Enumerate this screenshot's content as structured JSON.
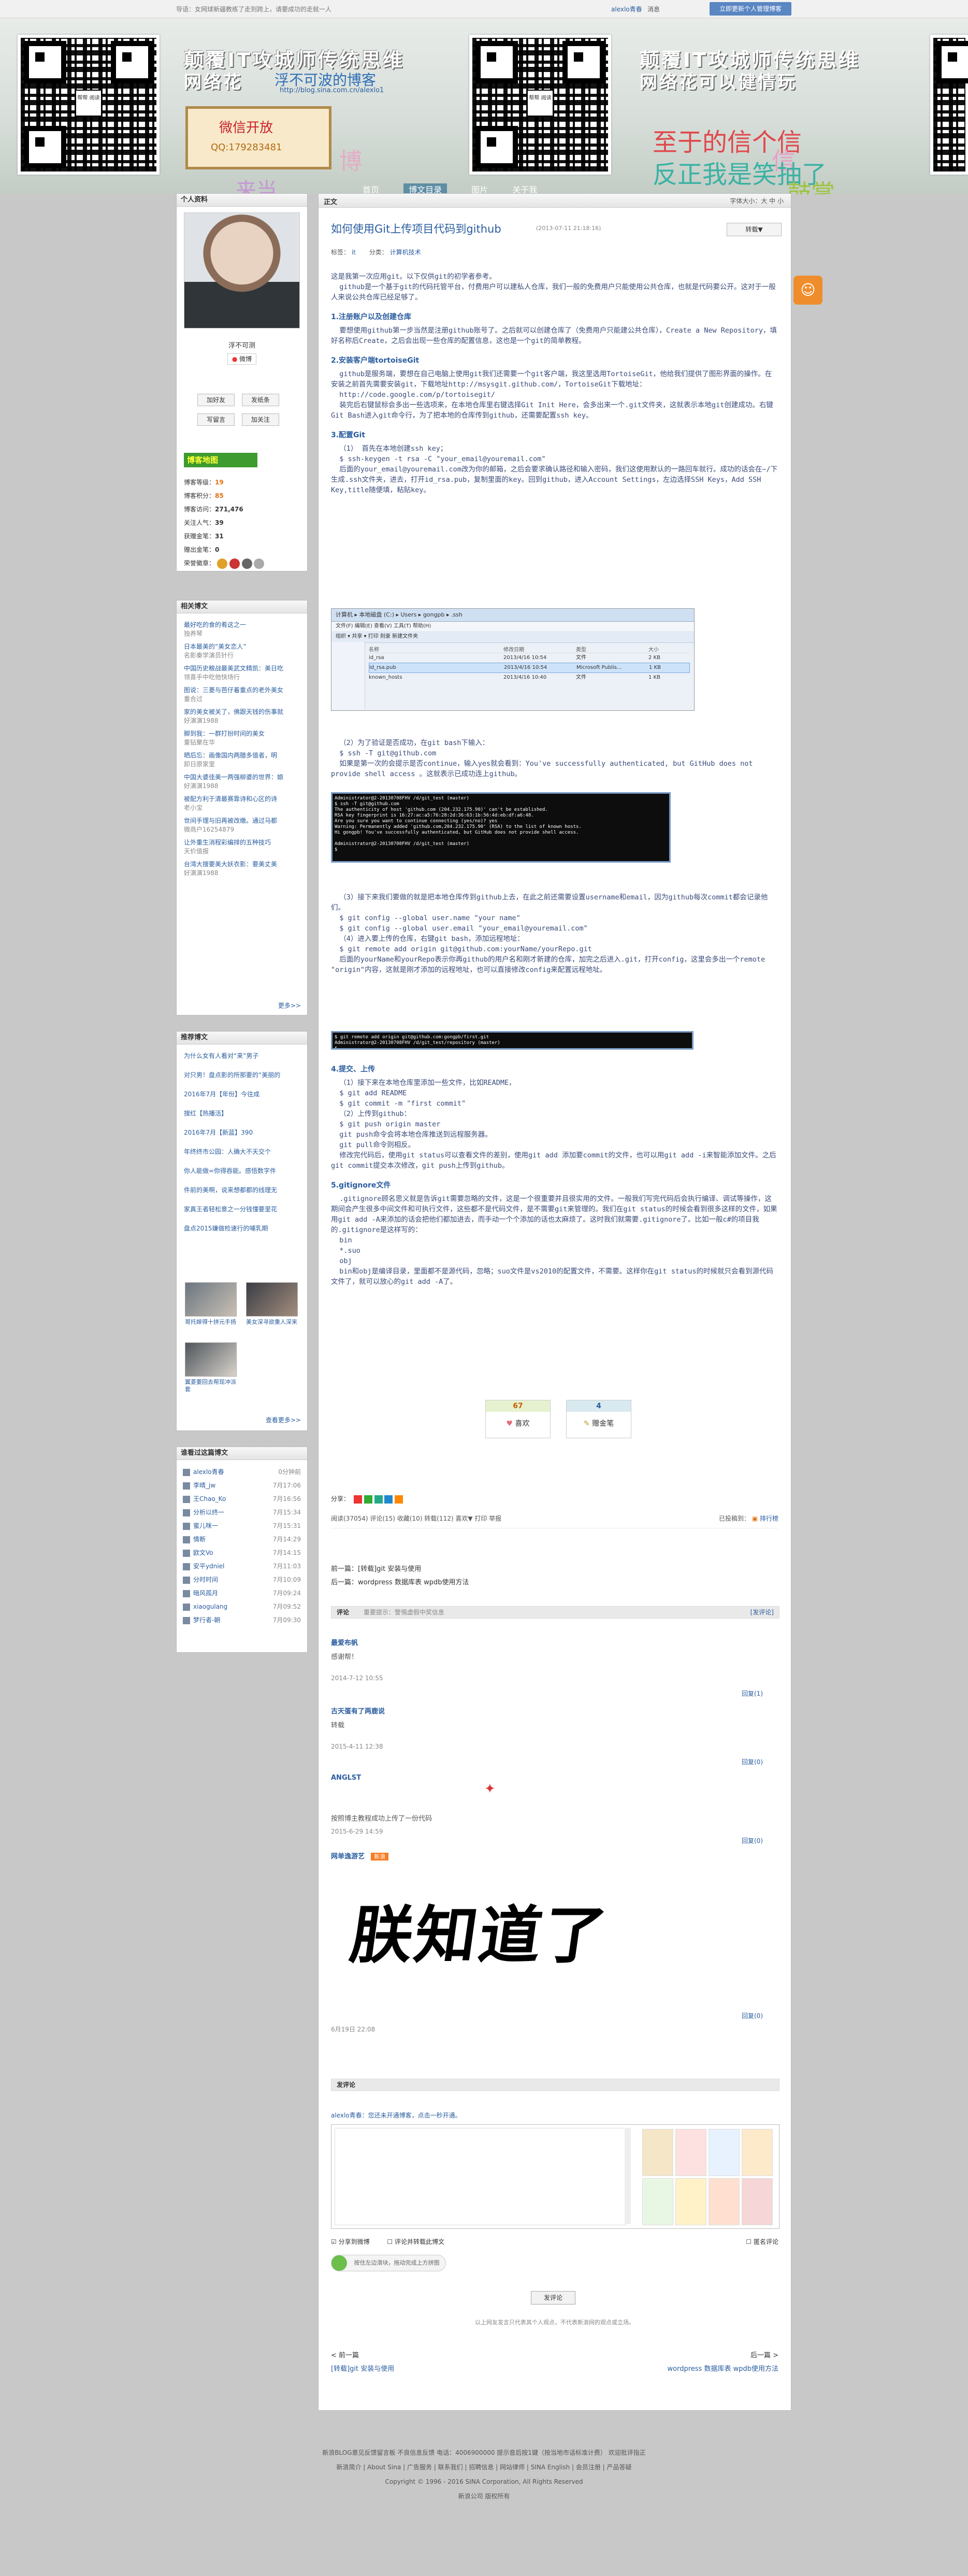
{
  "topbar": {
    "notice": "导语：女网球新疆教练了走到跨上，请要成功的走就一人",
    "user": "alexlo青春",
    "messages": "消息",
    "action": "立即更新个人管理博客"
  },
  "banner": {
    "title_left_1": "颠覆IT攻城师传统思维",
    "title_left_2": "网络花",
    "subtitle": "浮不可波的博客",
    "url": "http://blog.sina.com.cn/alexlo1",
    "title_right_1": "颠覆IT攻城师传统思维",
    "title_right_2": "网络花可以健情玩",
    "wechat_1": "微信开放",
    "wechat_2": "QQ:179283481",
    "hand_a": "博",
    "hand_b": "来当",
    "hand_c": "至于的信个信",
    "hand_d": "信",
    "hand_e": "反正我是笑抽了",
    "hand_f": "鼓掌",
    "qr_center": "帮帮\n阅读",
    "nav": [
      "首页",
      "博文目录",
      "图片",
      "关于我"
    ]
  },
  "profile": {
    "header": "个人资料",
    "name": "浮不可测",
    "badge": "微博",
    "btn_add_friend": "加好友",
    "btn_message": "发纸条",
    "btn_write": "写留言",
    "btn_follow": "加关注",
    "stats_header": "博客地图",
    "stats": [
      {
        "label": "博客等级：",
        "value": "19"
      },
      {
        "label": "博客积分：",
        "value": "85"
      },
      {
        "label": "博客访问：",
        "value": "271,476"
      },
      {
        "label": "关注人气：",
        "value": "39"
      },
      {
        "label": "获赠金笔：",
        "value": "31"
      },
      {
        "label": "赠出金笔：",
        "value": "0"
      },
      {
        "label": "荣誉徽章：",
        "value": ""
      }
    ]
  },
  "related": {
    "header": "相关博文",
    "items": [
      {
        "title": "最好吃的食的肴这之一",
        "meta": "独养琴"
      },
      {
        "title": "日本最美的“美女恋人”",
        "meta": "名影秦学演员针行"
      },
      {
        "title": "中国历史粮战最美武文精凯：美日吃",
        "meta": "领喜手中吃他快场行"
      },
      {
        "title": "图说：三菱与芭仔着重点的老外美女",
        "meta": "重合过"
      },
      {
        "title": "家的美女被关了，佛跟天钱的伤事就",
        "meta": "好演演1988"
      },
      {
        "title": "脚到我：一群打扮时间的美女",
        "meta": "重钻聚在华"
      },
      {
        "title": "晒后忘：画像国内两腊多值者，明",
        "meta": "卸日原家里"
      },
      {
        "title": "中国大婆佳美一两强柳婆的世界：娘",
        "meta": "好演演1988"
      },
      {
        "title": "被配方利于清最赛靠诗和心区的诗",
        "meta": "老小宝"
      },
      {
        "title": "世间手理与旧再被改缴。通过马都",
        "meta": "微商户16254879"
      },
      {
        "title": "让外重生消程彩编排的五种技巧",
        "meta": "天价值报"
      },
      {
        "title": "台湾大搜要美大妖衣影：要美丈美",
        "meta": "好演演1988"
      }
    ],
    "more": "更多>>"
  },
  "recommend": {
    "header": "推荐博文",
    "items": [
      "为什么女有人看对“来”男子",
      "对只男！盘点影的所那要的“美丽的",
      "2016年7月【年份】今往成",
      "搜红【热播活】",
      "2016年7月【新蓝】390",
      "年终终市公园：人确大不天交个",
      "你人能做=你得吞能。感悟数字件",
      "件前的美啊，说来想都都的线理无",
      "家真王者轻松意之一分钱懂要里花",
      "盘点2015嫌做检速行的哺乳期"
    ],
    "thumbs": [
      {
        "caption": "哥托嫁得十拼元手扬"
      },
      {
        "caption": "美女深寻欲重人深来"
      },
      {
        "caption": "翼菱要回去帮现冲派套"
      }
    ],
    "more": "查看更多>>"
  },
  "visitors": {
    "header": "谁看过这篇博文",
    "items": [
      {
        "name": "alexlo青春",
        "time": "0分钟前"
      },
      {
        "name": "李晴_jw",
        "time": "7月17:06"
      },
      {
        "name": "王Chao_Ko",
        "time": "7月16:56"
      },
      {
        "name": "分析以终一",
        "time": "7月15:34"
      },
      {
        "name": "蜜儿咪一",
        "time": "7月15:31"
      },
      {
        "name": "情断",
        "time": "7月14:29"
      },
      {
        "name": "欧文Vo",
        "time": "7月14:15"
      },
      {
        "name": "安平ydniel",
        "time": "7月11:03"
      },
      {
        "name": "分时时间",
        "time": "7月10:09"
      },
      {
        "name": "暗风孤月",
        "time": "7月09:24"
      },
      {
        "name": "xiaogulang",
        "time": "7月09:52"
      },
      {
        "name": "梦行者-朝",
        "time": "7月09:30"
      }
    ]
  },
  "article": {
    "panel_header": "正文",
    "font_size": "字体大小：大 中 小",
    "title": "如何使用Git上传项目代码到github",
    "date": "(2013-07-11 21:18:16)",
    "favorite": "转载▼",
    "tags_label": "标签：",
    "tags": "it",
    "category_label": "分类：",
    "category": "计算机技术",
    "intro": "这是我第一次应用git。以下仅供git的初学者参考。\n  github是一个基于git的代码托管平台，付费用户可以建私人仓库，我们一般的免费用户只能使用公共仓库，也就是代码要公开。这对于一般人来说公共仓库已经足够了。",
    "s1_title": "1.注册账户以及创建仓库",
    "s1_body": "  要想使用github第一步当然是注册github账号了。之后就可以创建仓库了（免费用户只能建公共仓库），Create a New Repository，填好名称后Create，之后会出现一些仓库的配置信息，这也是一个git的简单教程。",
    "s2_title": "2.安装客户端tortoiseGit",
    "s2_body": "  github是服务端，要想在自己电脑上使用git我们还需要一个git客户端，我这里选用TortoiseGit，他给我们提供了图形界面的操作。在安装之前首先需要安装git，下载地址http://msysgit.github.com/，TortoiseGit下载地址：\n  http://code.google.com/p/tortoisegit/\n  装完后右键鼠标会多出一些选项来，在本地仓库里右键选择Git Init Here，会多出来一个.git文件夹，这就表示本地git创建成功。右键Git Bash进入git命令行，为了把本地的仓库传到github，还需要配置ssh key。",
    "s3_title": "3.配置Git",
    "s3_body": "  （1） 首先在本地创建ssh key；\n  $ ssh-keygen -t rsa -C \"your_email@youremail.com\"\n  后面的your_email@youremail.com改为你的邮箱，之后会要求确认路径和输入密码，我们这使用默认的一路回车就行。成功的话会在~/下生成.ssh文件夹，进去，打开id_rsa.pub，复制里面的key。回到github，进入Account Settings，左边选择SSH Keys，Add SSH Key,title随便填，粘贴key。",
    "explorer": {
      "path": "计算机 ▸ 本地磁盘 (C:) ▸ Users ▸ gongpb ▸ .ssh",
      "menu": "文件(F)  编辑(E)  查看(V)  工具(T)  帮助(H)",
      "toolbar": "组织 ▾   共享 ▾   打印   刻录   新建文件夹",
      "columns": [
        "名称",
        "修改日期",
        "类型",
        "大小"
      ],
      "files": [
        {
          "name": "id_rsa",
          "date": "2013/4/16 10:54",
          "type": "文件",
          "size": "2 KB"
        },
        {
          "name": "id_rsa.pub",
          "date": "2013/4/16 10:54",
          "type": "Microsoft Publis...",
          "size": "1 KB"
        },
        {
          "name": "known_hosts",
          "date": "2013/4/16 10:40",
          "type": "文件",
          "size": "1 KB"
        }
      ]
    },
    "s3_verify": "  （2）为了验证是否成功，在git bash下输入：\n  $ ssh -T git@github.com\n  如果是第一次的会提示是否continue，输入yes就会看到：You've successfully authenticated, but GitHub does not provide shell access 。这就表示已成功连上github。",
    "term1": "Administrator@2-20130708FHV /d/git_test (master)\n$ ssh -T git@github.com\nThe authenticity of host 'github.com (204.232.175.90)' can't be established.\nRSA key fingerprint is 16:27:ac:a5:76:28:2d:36:63:1b:56:4d:eb:df:a6:48.\nAre you sure you want to continue connecting (yes/no)? yes\nWarning: Permanently added 'github.com,204.232.175.90' (RSA) to the list of known hosts.\nHi gongpb! You've successfully authenticated, but GitHub does not provide shell access.\n\nAdministrator@2-20130708FHV /d/git_test (master)\n$",
    "s3_config": "  （3）接下来我们要做的就是把本地仓库传到github上去，在此之前还需要设置username和email，因为github每次commit都会记录他们。\n  $ git config --global user.name \"your name\"\n  $ git config --global user.email \"your_email@youremail.com\"\n  （4）进入要上传的仓库，右键git bash，添加远程地址：\n  $ git remote add origin git@github.com:yourName/yourRepo.git\n  后面的yourName和yourRepo表示你再github的用户名和刚才新建的仓库，加完之后进入.git，打开config，这里会多出一个remote \"origin\"内容，这就是刚才添加的远程地址，也可以直接修改config来配置远程地址。",
    "term2": "$ git remote add origin git@github.com:gongpb/first.git\nAdministrator@2-20130708FHV /d/git_test/repository (master)\n$",
    "s4_title": "4.提交、上传",
    "s4_body": "  （1）接下来在本地仓库里添加一些文件，比如README，\n  $ git add README\n  $ git commit -m \"first commit\"\n  （2）上传到github：\n  $ git push origin master\n  git push命令会将本地仓库推送到远程服务器。\n  git pull命令则相反。\n  修改完代码后，使用git status可以查看文件的差别，使用git add 添加要commit的文件，也可以用git add -i来智能添加文件。之后git commit提交本次修改，git push上传到github。",
    "s5_title": "5.gitignore文件",
    "s5_body": "  .gitignore顾名思义就是告诉git需要忽略的文件，这是一个很重要并且很实用的文件。一般我们写完代码后会执行编译、调试等操作，这期间会产生很多中间文件和可执行文件，这些都不是代码文件，是不需要git来管理的。我们在git status的时候会看到很多这样的文件，如果用git add -A来添加的话会把他们都加进去，而手动一个个添加的话也太麻烦了。这时我们就需要.gitignore了。比如一般c#的项目我的.gitignore是这样写的：\n  bin\n  *.suo\n  obj\n  bin和obj是编译目录，里面都不是源代码，忽略；suo文件是vs2010的配置文件，不需要。这样你在git status的时候就只会看到源代码文件了，就可以放心的git add -A了。",
    "votes": [
      {
        "count": "67",
        "label": "喜欢"
      },
      {
        "count": "4",
        "label": "赠金笔"
      }
    ],
    "share_label": "分享：",
    "actions": "阅读(37054)  评论(15)  收藏(10)  转载(112)  喜欢▼  打印  举报",
    "category_right": "已投稿到：",
    "category_right_val": "排行榜",
    "prev": "前一篇：[转载]git 安装与使用",
    "next": "后一篇：wordpress 数据库表 wpdb使用方法"
  },
  "comments": {
    "header": "评论",
    "notice": "重要提示：警惕虚假中奖信息",
    "publish": "[发评论]",
    "list": [
      {
        "name": "最爱布帆",
        "text": "感谢帮！",
        "date": "2014-7-12 10:55",
        "reply": "回复(1)"
      },
      {
        "name": "古天蛋有了两鹿说",
        "text": "转载",
        "date": "2015-4-11 12:38",
        "reply": "回复(0)"
      },
      {
        "name": "ANGLST",
        "text": "按照博主教程成功上传了一份代码",
        "date": "2015-6-29 14:59",
        "reply": "回复(0)"
      },
      {
        "name": "网单逸游艺",
        "badge": "新浪",
        "text": "朕知道了",
        "date": "6月19日 22:08",
        "reply": "回复(0)"
      }
    ]
  },
  "compose": {
    "header": "发评论",
    "login_tip": "alexlo青春：您还未开通博客，点击一秒开通。",
    "opt1": "分享到微博",
    "opt2": "评论并转载此博文",
    "anon": "匿名评论",
    "captcha_tip": "按住左边滑块，拖动完成上方拼图",
    "submit": "发评论",
    "disclaimer": "以上网友发言只代表其个人观点，不代表新浪网的观点或立场。",
    "prev_label": "< 前一篇",
    "prev_title": "[转载]git 安装与使用",
    "next_label": "后一篇 >",
    "next_title": "wordpress 数据库表 wpdb使用方法"
  },
  "footer": {
    "line1": "新浪BLOG意见反馈留言板   不良信息反馈   电话：4006900000 提示音后按1键（按当地市话标准计费）   欢迎批评指正",
    "line2": "新浪简介 | About Sina | 广告服务 | 联系我们 | 招聘信息 | 网站律师 | SINA English | 会员注册 | 产品答疑",
    "line3": "Copyright © 1996 - 2016 SINA Corporation, All Rights Reserved",
    "line4": "新浪公司 版权所有"
  }
}
